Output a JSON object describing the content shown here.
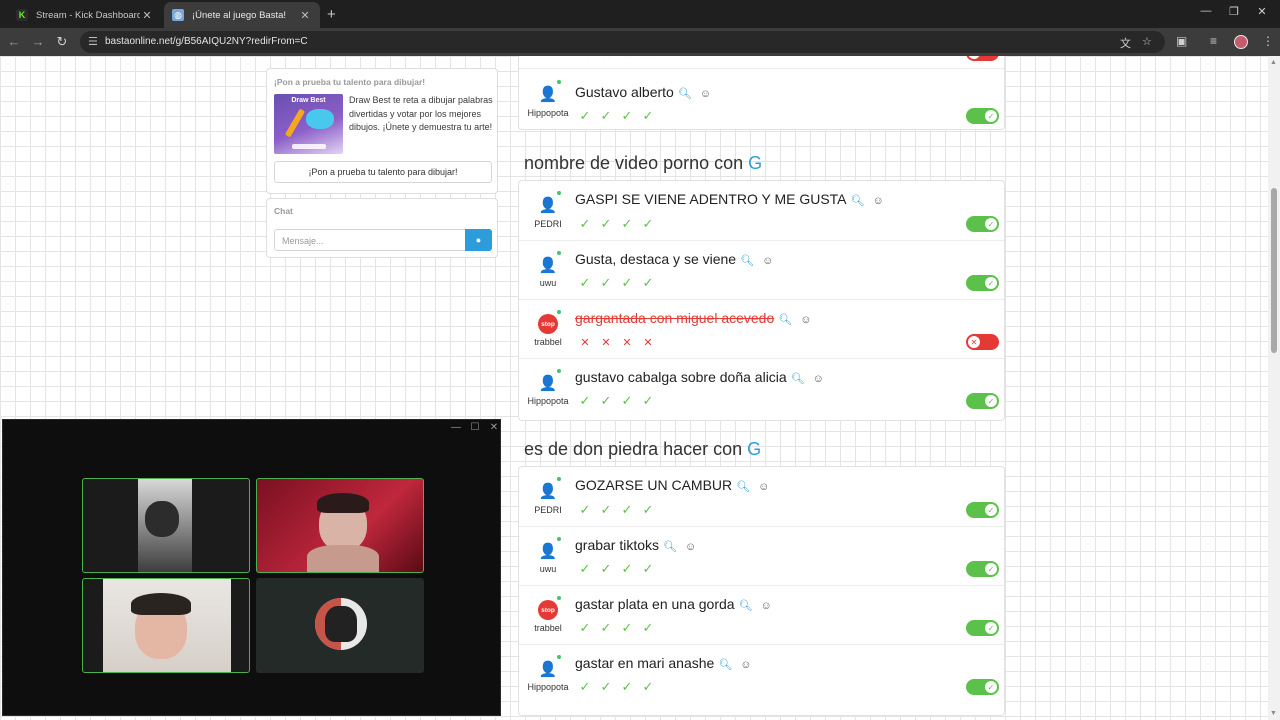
{
  "browser": {
    "tabs": [
      {
        "title": "Stream - Kick Dashboard",
        "active": false,
        "favicon": "kick-logo-icon"
      },
      {
        "title": "¡Únete al juego Basta!",
        "active": true,
        "favicon": "basta-globe-icon"
      }
    ],
    "url": "bastaonline.net/g/B56AIQU2NY?redirFrom=C"
  },
  "sidebar": {
    "promo": {
      "title": "¡Pon a prueba tu talento para dibujar!",
      "image_title": "Draw Best",
      "text": "Draw Best te reta a dibujar palabras divertidas y votar por los mejores dibujos. ¡Únete y demuestra tu arte!",
      "button": "¡Pon a prueba tu talento para dibujar!"
    },
    "chat": {
      "title": "Chat",
      "placeholder": "Mensaje...",
      "send_icon": "send-message-icon"
    }
  },
  "answers": {
    "top_card": {
      "rows": [
        {
          "player": "Hippopota",
          "answer": "Gustavo alberto",
          "accepted": true,
          "avatar": "person"
        }
      ]
    },
    "categories": [
      {
        "title": "nombre de video porno con",
        "letter": "G",
        "rows": [
          {
            "player": "PEDRI",
            "answer": "GASPI SE VIENE ADENTRO Y ME GUSTA",
            "accepted": true,
            "avatar": "person"
          },
          {
            "player": "uwu",
            "answer": "Gusta, destaca y se viene",
            "accepted": true,
            "avatar": "person"
          },
          {
            "player": "trabbel",
            "answer": "gargantada con miguel acevedo",
            "accepted": false,
            "avatar": "stop"
          },
          {
            "player": "Hippopota",
            "answer": "gustavo cabalga sobre doña alicia",
            "accepted": true,
            "avatar": "person"
          }
        ]
      },
      {
        "title": "es de don piedra hacer con",
        "letter": "G",
        "rows": [
          {
            "player": "PEDRI",
            "answer": "GOZARSE UN CAMBUR",
            "accepted": true,
            "avatar": "person"
          },
          {
            "player": "uwu",
            "answer": "grabar tiktoks",
            "accepted": true,
            "avatar": "person"
          },
          {
            "player": "trabbel",
            "answer": "gastar plata en una gorda",
            "accepted": true,
            "avatar": "stop"
          },
          {
            "player": "Hippopota",
            "answer": "gastar en mari anashe",
            "accepted": true,
            "avatar": "person"
          }
        ]
      }
    ],
    "stop_badge": "stop"
  },
  "video_call": {
    "participants": [
      {
        "speaking": true
      },
      {
        "speaking": true
      },
      {
        "speaking": true
      },
      {
        "speaking": false,
        "avatar": "skull-avatar-icon"
      }
    ]
  },
  "colors": {
    "accent": "#2d9cdb",
    "accepted": "#5cc14a",
    "rejected": "#e53935"
  }
}
